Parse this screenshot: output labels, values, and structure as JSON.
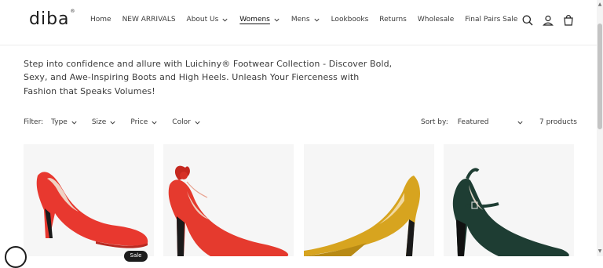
{
  "brand": {
    "logo_text": "diba",
    "logo_mark": "®"
  },
  "nav": [
    {
      "label": "Home"
    },
    {
      "label": "NEW ARRIVALS"
    },
    {
      "label": "About Us",
      "dropdown": true
    },
    {
      "label": "Womens",
      "dropdown": true,
      "active": true
    },
    {
      "label": "Mens",
      "dropdown": true
    },
    {
      "label": "Lookbooks"
    },
    {
      "label": "Returns"
    },
    {
      "label": "Wholesale"
    },
    {
      "label": "Final Pairs Sale"
    }
  ],
  "header_icons": [
    "search-icon",
    "account-icon",
    "cart-icon"
  ],
  "intro": "Step into confidence and allure with Luichiny® Footwear Collection - Discover Bold, Sexy, and Awe-Inspiring Boots and High Heels. Unleash Your Fierceness with Fashion that Speaks Volumes!",
  "filters": {
    "label": "Filter:",
    "items": [
      "Type",
      "Size",
      "Price",
      "Color"
    ]
  },
  "sort": {
    "label": "Sort by:",
    "value": "Featured"
  },
  "product_count": "7 products",
  "products": [
    {
      "shoe_color": "#e8382f",
      "badge": "Sale"
    },
    {
      "shoe_color": "#e53a2e"
    },
    {
      "shoe_color": "#d7a41f"
    },
    {
      "shoe_color": "#1e3d33"
    }
  ],
  "colors": {
    "text": "#3b3b3b",
    "badge_bg": "#1c1c1c",
    "card_bg": "#f6f6f6"
  }
}
